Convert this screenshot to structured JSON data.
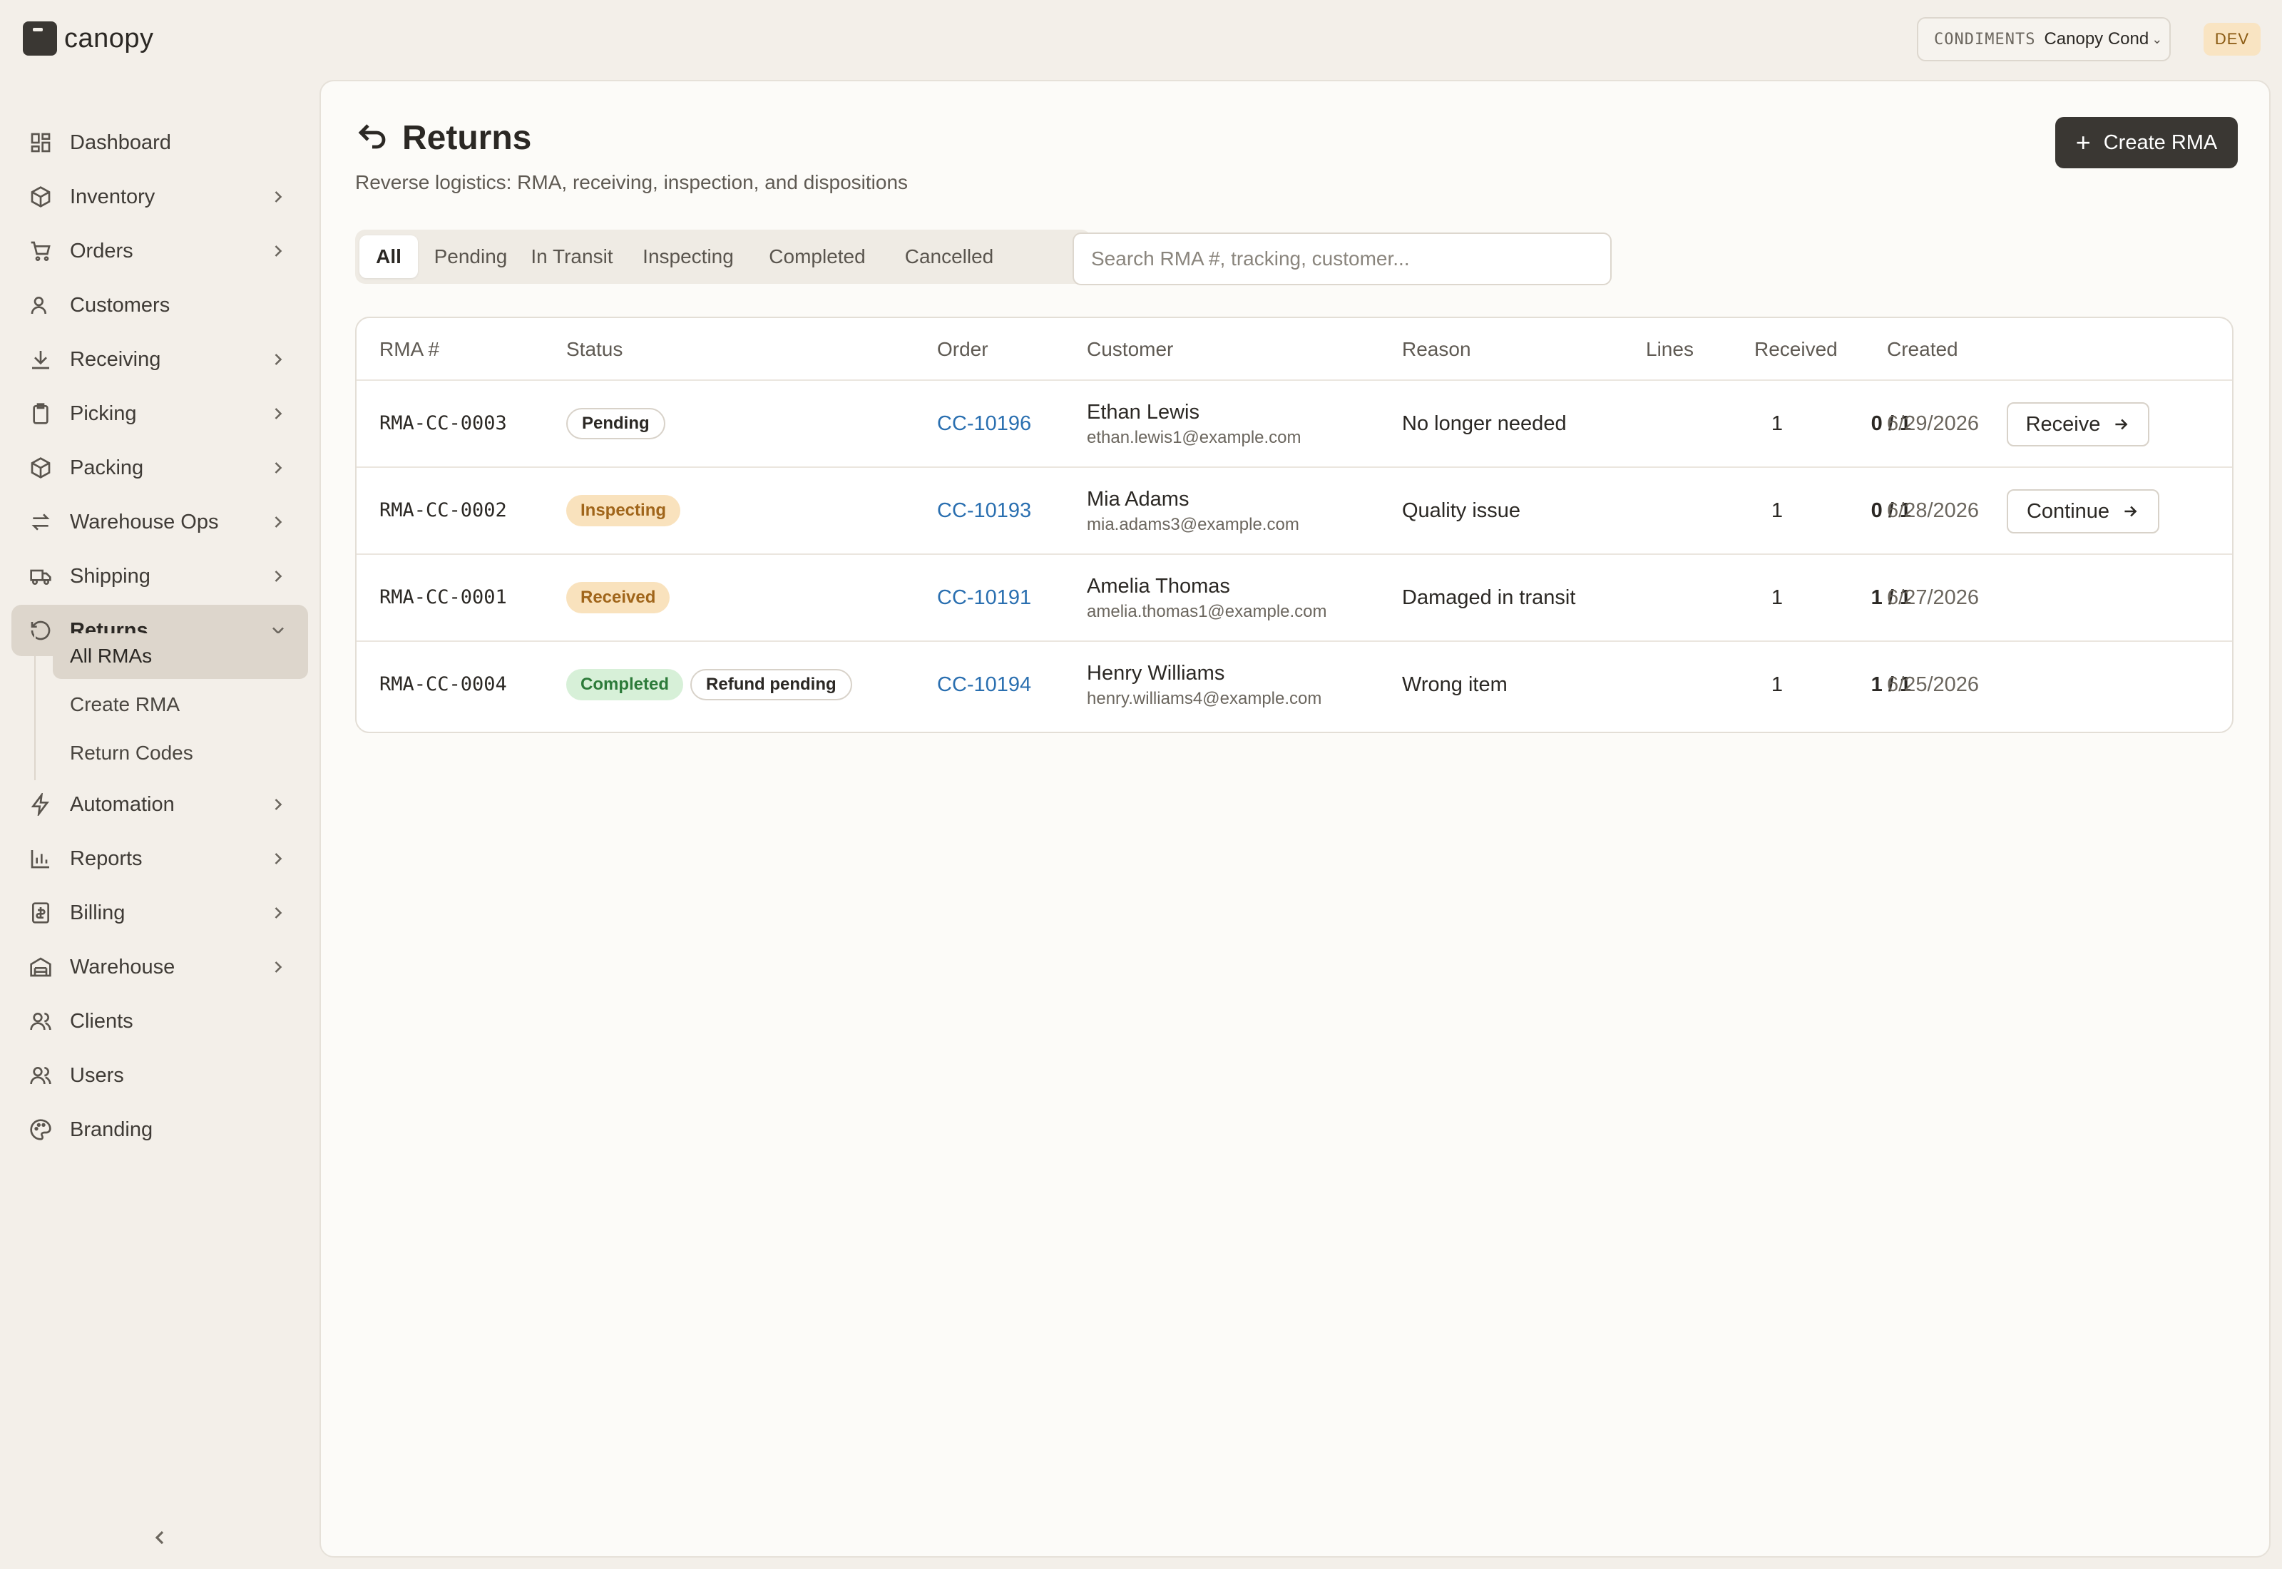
{
  "brand": {
    "name": "canopy"
  },
  "tenant": {
    "kind": "CONDIMENTS",
    "name": "Canopy Cond"
  },
  "env": "DEV",
  "sidebar": {
    "items": [
      {
        "label": "Dashboard",
        "icon": "dashboard-icon"
      },
      {
        "label": "Inventory",
        "icon": "package-icon"
      },
      {
        "label": "Orders",
        "icon": "cart-icon"
      },
      {
        "label": "Customers",
        "icon": "customer-icon"
      },
      {
        "label": "Receiving",
        "icon": "download-icon"
      },
      {
        "label": "Picking",
        "icon": "clipboard-icon"
      },
      {
        "label": "Packing",
        "icon": "package-icon"
      },
      {
        "label": "Warehouse Ops",
        "icon": "swap-icon"
      },
      {
        "label": "Shipping",
        "icon": "truck-icon"
      },
      {
        "label": "Returns",
        "icon": "return-icon"
      },
      {
        "label": "Automation",
        "icon": "bolt-icon"
      },
      {
        "label": "Reports",
        "icon": "bar-chart-icon"
      },
      {
        "label": "Billing",
        "icon": "receipt-icon"
      },
      {
        "label": "Warehouse",
        "icon": "warehouse-icon"
      },
      {
        "label": "Clients",
        "icon": "users-icon"
      },
      {
        "label": "Users",
        "icon": "users-icon"
      },
      {
        "label": "Branding",
        "icon": "palette-icon"
      }
    ],
    "returns_sub": [
      {
        "label": "All RMAs"
      },
      {
        "label": "Create RMA"
      },
      {
        "label": "Return Codes"
      }
    ]
  },
  "page": {
    "title": "Returns",
    "subtitle": "Reverse logistics: RMA, receiving, inspection, and dispositions",
    "create_label": "Create RMA"
  },
  "tabs": [
    "All",
    "Pending",
    "In Transit",
    "Inspecting",
    "Completed",
    "Cancelled"
  ],
  "search": {
    "placeholder": "Search RMA #, tracking, customer...",
    "value": ""
  },
  "table": {
    "columns": [
      "RMA #",
      "Status",
      "Order",
      "Customer",
      "Reason",
      "Lines",
      "Received",
      "Created"
    ],
    "rows": [
      {
        "rma": "RMA-CC-0003",
        "status": "Pending",
        "extra_status": "",
        "order": "CC-10196",
        "customer": "Ethan Lewis",
        "email": "ethan.lewis1@example.com",
        "reason": "No longer needed",
        "lines": "1",
        "received": "0 / 1",
        "created": "6/29/2026",
        "action": "Receive"
      },
      {
        "rma": "RMA-CC-0002",
        "status": "Inspecting",
        "extra_status": "",
        "order": "CC-10193",
        "customer": "Mia Adams",
        "email": "mia.adams3@example.com",
        "reason": "Quality issue",
        "lines": "1",
        "received": "0 / 1",
        "created": "6/28/2026",
        "action": "Continue"
      },
      {
        "rma": "RMA-CC-0001",
        "status": "Received",
        "extra_status": "",
        "order": "CC-10191",
        "customer": "Amelia Thomas",
        "email": "amelia.thomas1@example.com",
        "reason": "Damaged in transit",
        "lines": "1",
        "received": "1 / 1",
        "created": "6/27/2026",
        "action": ""
      },
      {
        "rma": "RMA-CC-0004",
        "status": "Completed",
        "extra_status": "Refund pending",
        "order": "CC-10194",
        "customer": "Henry Williams",
        "email": "henry.williams4@example.com",
        "reason": "Wrong item",
        "lines": "1",
        "received": "1 / 1",
        "created": "6/25/2026",
        "action": ""
      }
    ]
  },
  "colors": {
    "accent": "#3a3733",
    "link": "#2a6fb0",
    "pending_badge": "#ffffff",
    "inspecting_badge": "#f9e2bd",
    "completed_badge": "#d7f0d8",
    "env_badge": "#f9e4c2"
  }
}
